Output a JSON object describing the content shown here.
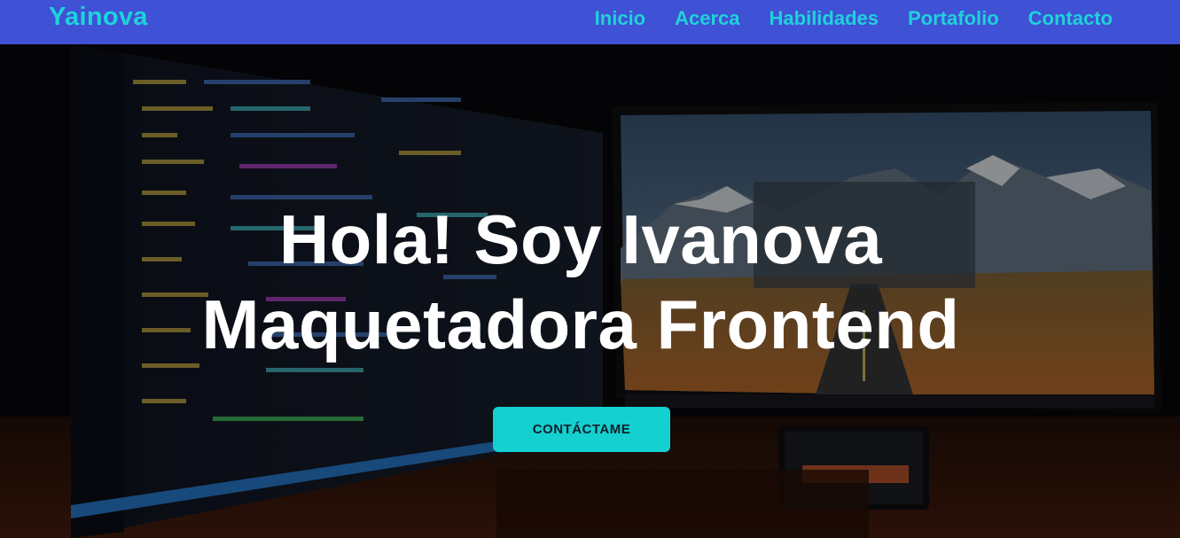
{
  "navbar": {
    "brand": "Yainova",
    "links": [
      {
        "label": "Inicio"
      },
      {
        "label": "Acerca"
      },
      {
        "label": "Habilidades"
      },
      {
        "label": "Portafolio"
      },
      {
        "label": "Contacto"
      }
    ]
  },
  "hero": {
    "title_line_1": "Hola! Soy Ivanova",
    "title_line_2": "Maquetadora Frontend",
    "cta_label": "CONTÁCTAME"
  },
  "colors": {
    "navbar_bg": "#3f51d4",
    "accent": "#1fd2da",
    "button_bg": "#14d0d0",
    "title_text": "#ffffff"
  }
}
